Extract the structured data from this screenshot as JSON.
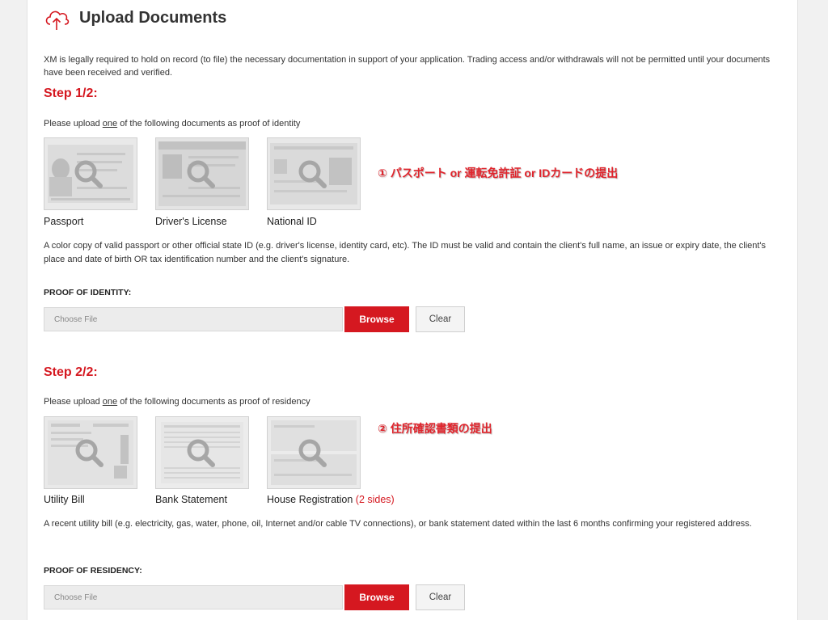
{
  "header": {
    "title": "Upload Documents",
    "icon": "cloud-upload-icon"
  },
  "intro": "XM is legally required to hold on record (to file) the necessary documentation in support of your application. Trading access and/or withdrawals will not be permitted until your documents have been received and verified.",
  "colors": {
    "accent": "#d51820",
    "note": "#e0242c"
  },
  "step1": {
    "title": "Step 1/2:",
    "instruction_pre": "Please upload ",
    "instruction_underlined": "one",
    "instruction_post": " of the following documents as proof of identity",
    "documents": [
      {
        "label": "Passport"
      },
      {
        "label": "Driver's License"
      },
      {
        "label": "National ID"
      }
    ],
    "annotation": "① パスポート or 運転免許証 or IDカードの提出",
    "description": "A color copy of valid passport or other official state ID (e.g. driver's license, identity card, etc). The ID must be valid and contain the client's full name, an issue or expiry date, the client's place and date of birth OR tax identification number and the client's signature.",
    "field_label": "PROOF OF IDENTITY:",
    "file_placeholder": "Choose File",
    "browse_label": "Browse",
    "clear_label": "Clear"
  },
  "step2": {
    "title": "Step 2/2:",
    "instruction_pre": "Please upload ",
    "instruction_underlined": "one",
    "instruction_post": " of the following documents as proof of residency",
    "documents": [
      {
        "label": "Utility Bill",
        "extra": ""
      },
      {
        "label": "Bank Statement",
        "extra": ""
      },
      {
        "label": "House Registration ",
        "extra": "(2 sides)"
      }
    ],
    "annotation": "② 住所確認書類の提出",
    "description": "A recent utility bill (e.g. electricity, gas, water, phone, oil, Internet and/or cable TV connections), or bank statement dated within the last 6 months confirming your registered address.",
    "field_label": "PROOF OF RESIDENCY:",
    "file_placeholder": "Choose File",
    "browse_label": "Browse",
    "clear_label": "Clear"
  }
}
